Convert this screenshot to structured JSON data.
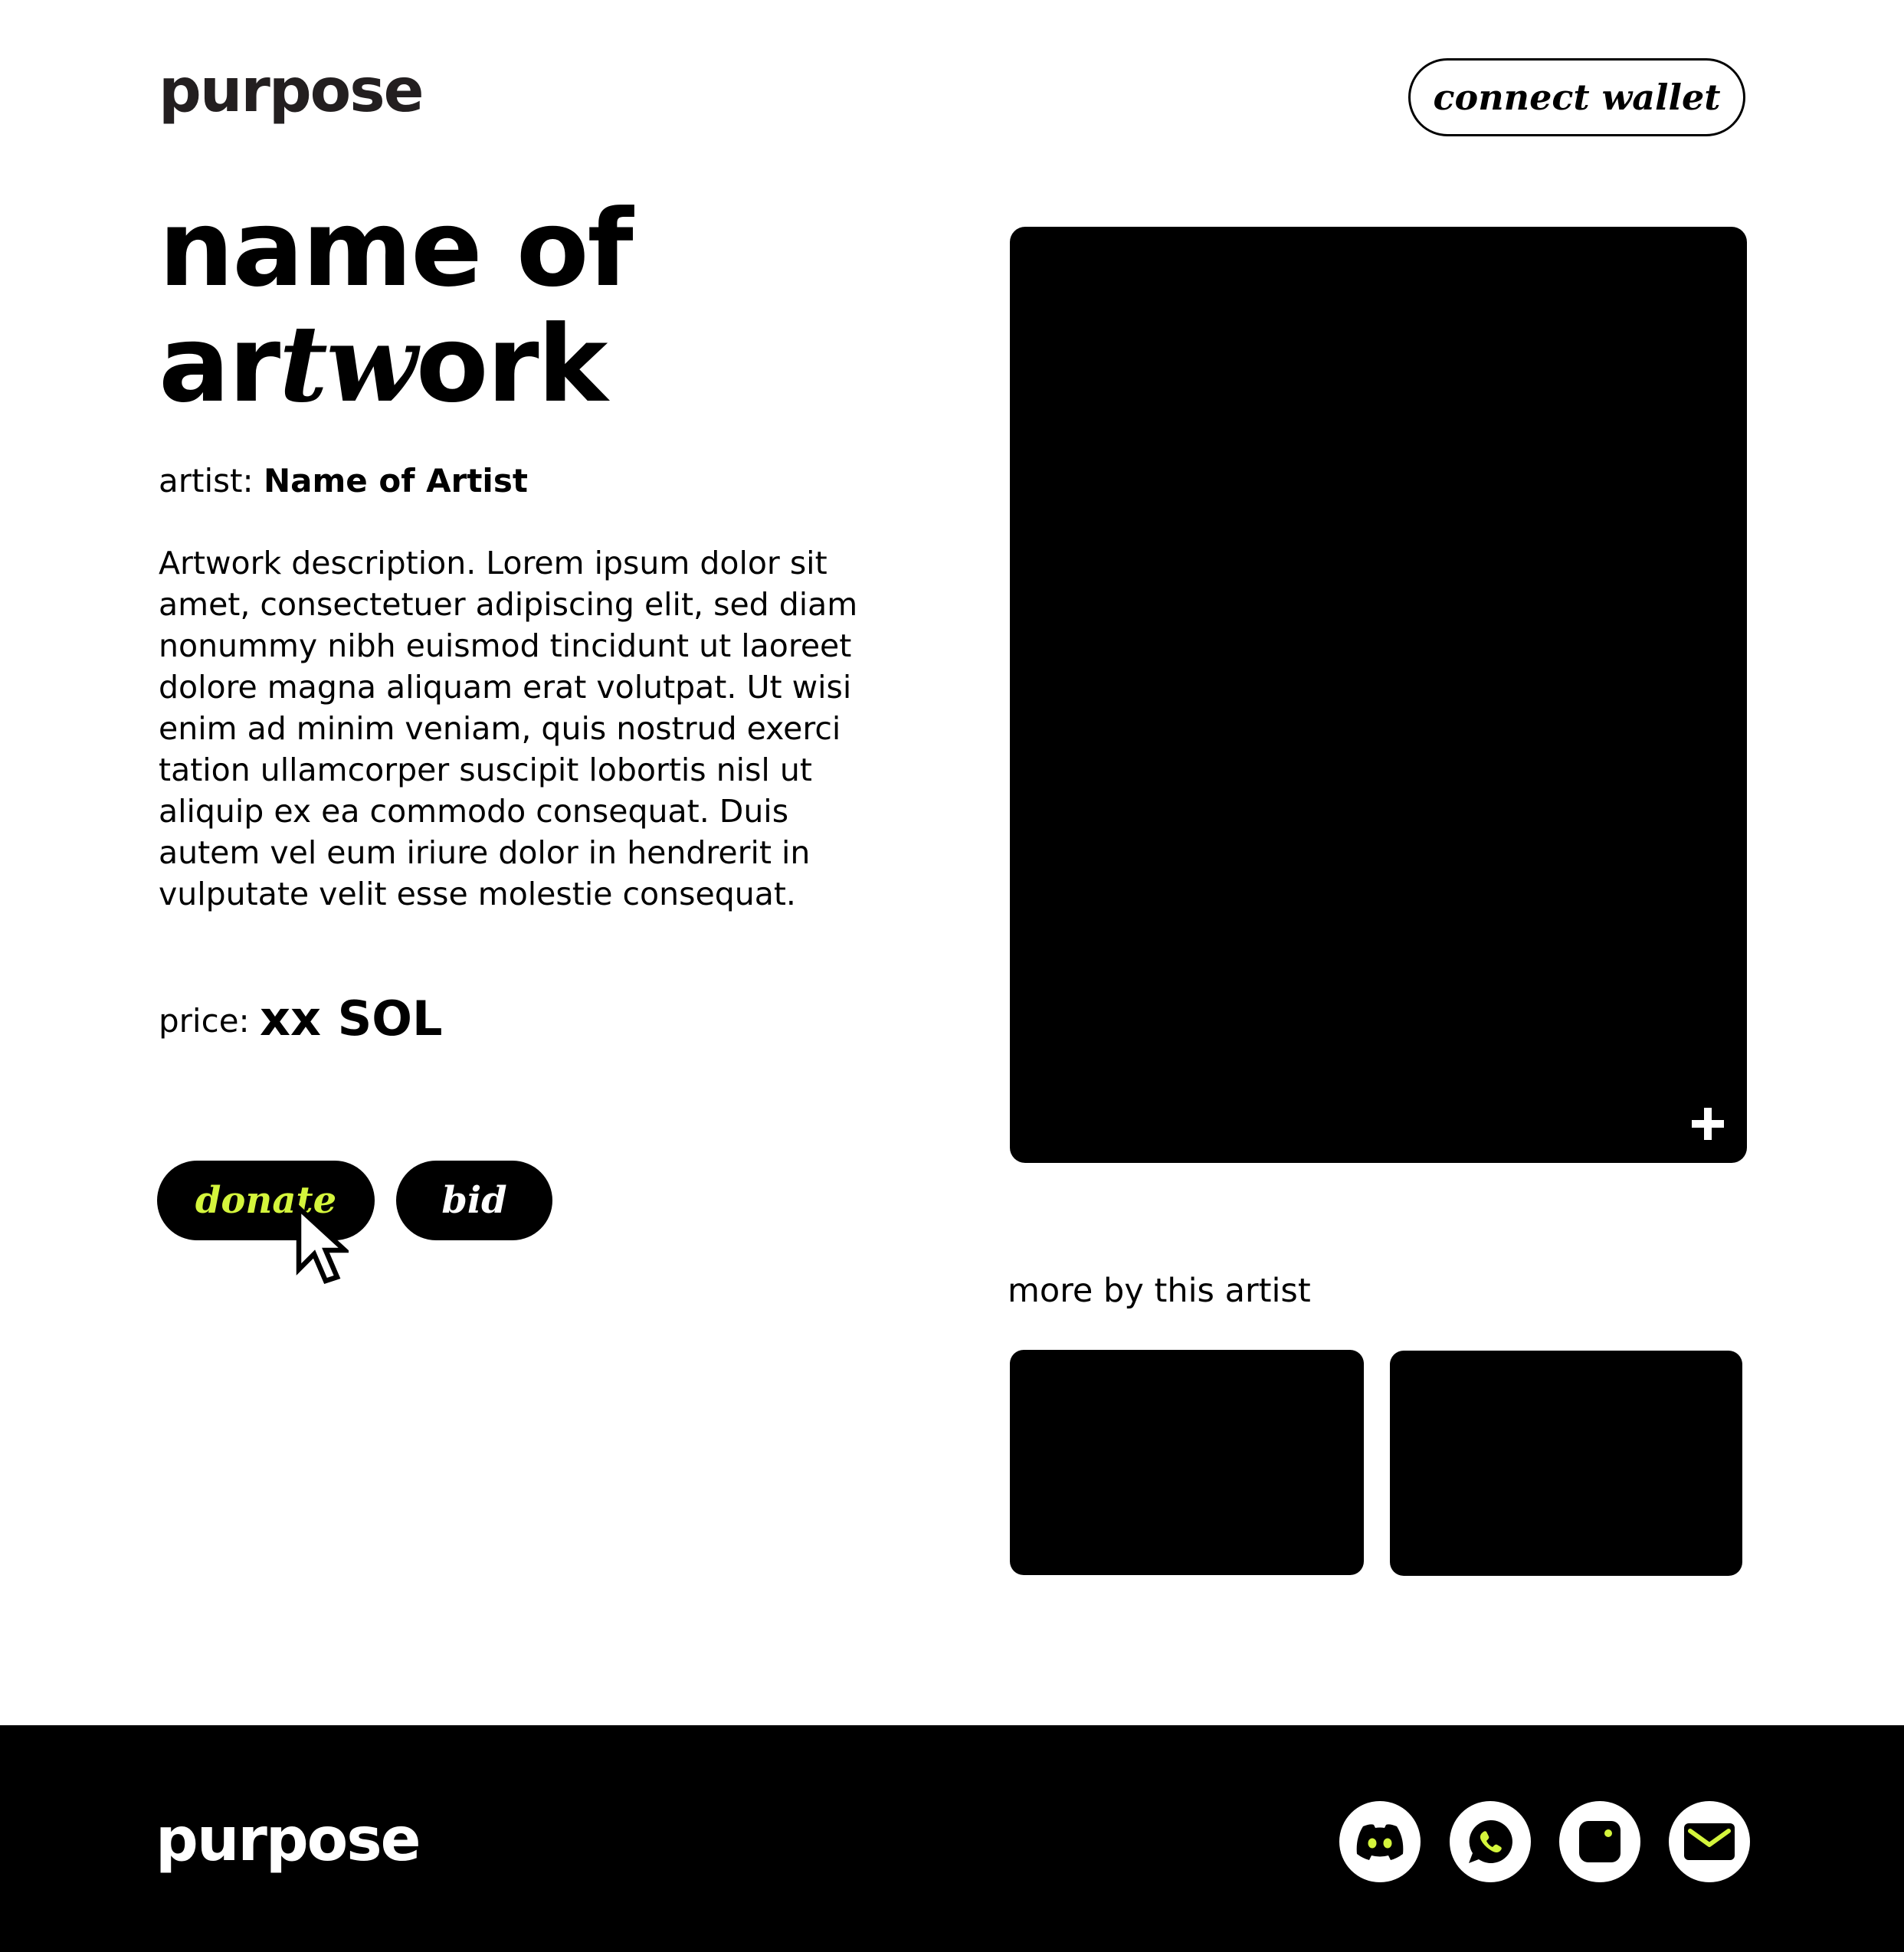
{
  "header": {
    "logo_text": "purpose",
    "connect_wallet_label": "connect wallet"
  },
  "artwork": {
    "title_line1": "name of",
    "title_line2_a": "ar",
    "title_line2_b": "tw",
    "title_line2_c": "ork",
    "artist_label": "artist:",
    "artist_name": "Name of Artist",
    "description": "Artwork description. Lorem ipsum dolor sit amet, consectetuer adipiscing elit, sed diam nonummy nibh euismod tincidunt ut laoreet dolore magna aliquam erat volutpat. Ut wisi enim ad minim veniam, quis nostrud exerci tation ullamcorper suscipit lobortis nisl ut aliquip ex ea commodo consequat. Duis autem vel eum iriure dolor in hendrerit in vulputate velit esse molestie consequat.",
    "price_label": "price:",
    "price_value": "xx SOL"
  },
  "actions": {
    "donate_label": "donate",
    "bid_label": "bid"
  },
  "more": {
    "label": "more by this artist"
  },
  "footer": {
    "logo_text": "purpose",
    "social_icons": [
      "discord-icon",
      "whatsapp-icon",
      "instagram-icon",
      "email-icon"
    ]
  },
  "colors": {
    "accent": "#d4f53c",
    "background": "#ffffff",
    "ink": "#000000"
  }
}
